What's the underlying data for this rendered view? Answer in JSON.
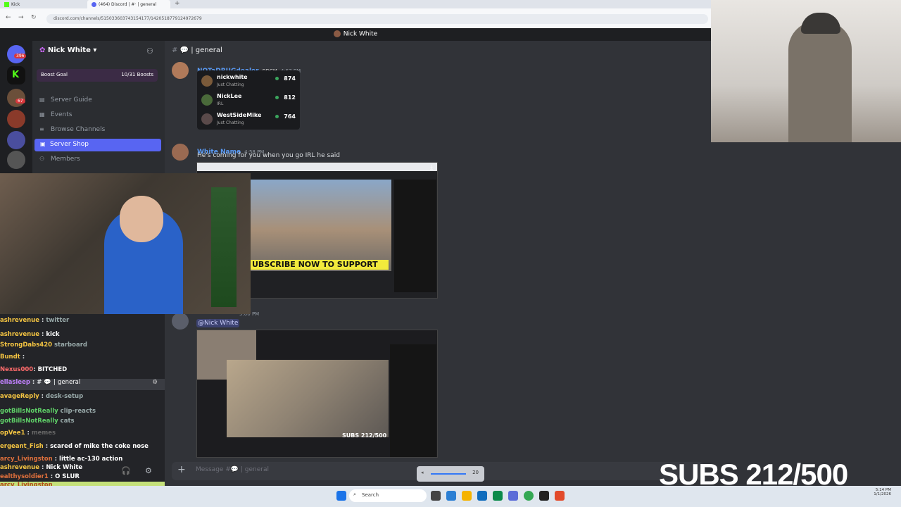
{
  "browser": {
    "tab1": "Kick",
    "tab2": "(464) Discord | #· | general",
    "url": "discord.com/channels/515033603743154177/1420518779124972679"
  },
  "window_title": "Nick White",
  "server": {
    "name": "Nick White",
    "boost_label": "Boost Goal",
    "boost_count": "10/31 Boosts",
    "badges": [
      "396",
      "67"
    ]
  },
  "channels": [
    {
      "name": "Server Guide",
      "icon": "book-icon"
    },
    {
      "name": "Events",
      "icon": "calendar-icon"
    },
    {
      "name": "Browse Channels",
      "icon": "list-icon"
    },
    {
      "name": "Server Shop",
      "icon": "shop-icon",
      "active": true
    },
    {
      "name": "Members",
      "icon": "members-icon"
    }
  ],
  "chat": {
    "channel": "general",
    "msg1": {
      "user": "NOTaDRUGdealer",
      "tag": "BDCM",
      "time": "4:57 PM"
    },
    "leaderboard": [
      {
        "name": "nickwhite",
        "sub": "Just Chatting",
        "value": "874"
      },
      {
        "name": "NickLee",
        "sub": "IRL",
        "value": "812"
      },
      {
        "name": "WestSideMike",
        "sub": "Just Chatting",
        "value": "764"
      }
    ],
    "msg2": {
      "user": "White Name",
      "time": "4:58 PM",
      "text": "He's coming for you when you go IRL he said"
    },
    "embed1_caption": "UBSCRIBE NOW TO SUPPORT",
    "msg3": {
      "mention": "@Nick White",
      "time": "5:00 PM"
    },
    "embed2_caption": "SUBS 212/500",
    "composer_placeholder": "Message #💬 | general"
  },
  "stream_chat": [
    {
      "user": "ashrevenue",
      "text": "twitter",
      "color": "#f5c542"
    },
    {
      "user": "ashrevenue",
      "text": "kick",
      "color": "#f5c542"
    },
    {
      "user": "StrongDabs420",
      "text": "starboard",
      "color": "#f5c542"
    },
    {
      "user": "Bundt",
      "text": "",
      "color": "#f5c542"
    },
    {
      "user": "Nexus000",
      "text": "BITCHED",
      "color": "#ff6b6b"
    },
    {
      "user": "ellasleep",
      "text": "general",
      "color": "#c080ff"
    },
    {
      "user": "avageReply",
      "text": "desk-setup",
      "color": "#f5c542"
    },
    {
      "user": "gotBillsNotReally",
      "text": "clip-reacts",
      "color": "#5fd068"
    },
    {
      "user": "gotBillsNotReally",
      "text": "cats",
      "color": "#5fd068"
    },
    {
      "user": "opVee1",
      "text": "memes",
      "color": "#f5c542"
    },
    {
      "user": "ergeant_Fish",
      "text": "scared of mike the coke nose",
      "color": "#f5c542"
    },
    {
      "user": "arcy_Livingston",
      "text": "little ac-130 action",
      "color": "#e0703c"
    },
    {
      "user": "ashrevenue",
      "text": "Nick White",
      "color": "#f5c542"
    },
    {
      "user": "ealthysoldier1",
      "text": "O SLUR",
      "color": "#e0703c"
    },
    {
      "user": "arcy_Livingston",
      "text": "",
      "color": "#e0703c"
    }
  ],
  "overlay_subs": "SUBS 212/500",
  "volume": "20",
  "taskbar": {
    "search": "Search",
    "time": "5:14 PM",
    "date": "1/1/2026"
  }
}
